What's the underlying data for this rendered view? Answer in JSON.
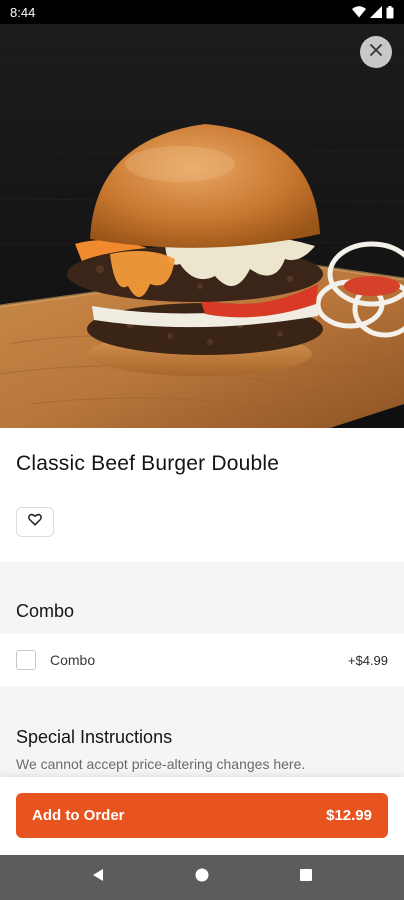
{
  "status_bar": {
    "time": "8:44",
    "icons": [
      "wifi-icon",
      "cell-signal-icon",
      "battery-icon"
    ]
  },
  "hero": {
    "image_subject": "double beef burger with cheese, tomato and onion on wooden board",
    "close_icon": "close-icon"
  },
  "item": {
    "title": "Classic Beef Burger Double",
    "favorite_icon": "heart-outline-icon"
  },
  "combo": {
    "heading": "Combo",
    "option_label": "Combo",
    "option_price": "+$4.99",
    "checked": false
  },
  "special_instructions": {
    "heading": "Special Instructions",
    "subtitle": "We cannot accept price-altering changes here."
  },
  "order_button": {
    "label": "Add to Order",
    "price": "$12.99"
  },
  "colors": {
    "accent": "#e8541f",
    "section_bg": "#f5f5f5",
    "nav_bar": "#5c5c5c"
  },
  "nav_bar": {
    "icons": [
      "back-icon",
      "home-icon",
      "recents-icon"
    ]
  }
}
